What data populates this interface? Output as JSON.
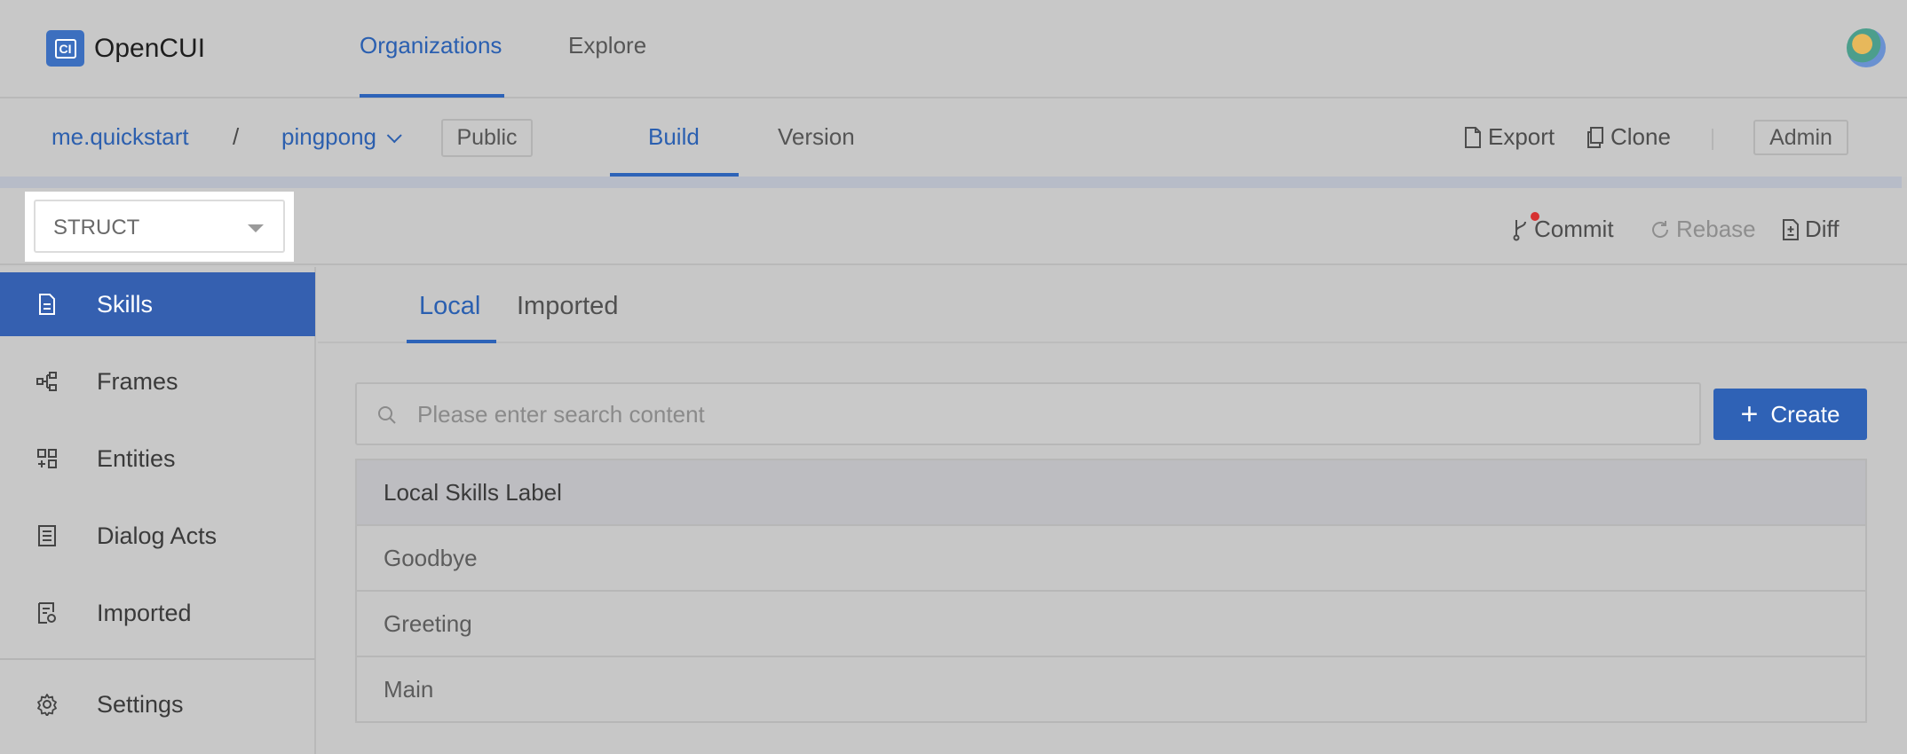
{
  "app": {
    "name": "OpenCUI"
  },
  "topnav": {
    "links": [
      {
        "label": "Organizations"
      },
      {
        "label": "Explore"
      }
    ]
  },
  "project": {
    "org": "me.quickstart",
    "separator": "/",
    "name": "pingpong",
    "visibility": "Public",
    "tabs": [
      {
        "label": "Build"
      },
      {
        "label": "Version"
      }
    ],
    "actions": {
      "export": "Export",
      "clone": "Clone",
      "admin": "Admin"
    }
  },
  "toolbar": {
    "mode_select": {
      "value": "STRUCT"
    },
    "commit": "Commit",
    "rebase": "Rebase",
    "diff": "Diff"
  },
  "sidebar": {
    "items": [
      {
        "label": "Skills",
        "icon": "document-icon",
        "active": true
      },
      {
        "label": "Frames",
        "icon": "frames-icon"
      },
      {
        "label": "Entities",
        "icon": "entities-icon"
      },
      {
        "label": "Dialog Acts",
        "icon": "dialog-acts-icon"
      },
      {
        "label": "Imported",
        "icon": "imported-icon"
      },
      {
        "label": "Settings",
        "icon": "gear-icon"
      }
    ]
  },
  "main": {
    "tabs": [
      {
        "label": "Local"
      },
      {
        "label": "Imported"
      }
    ],
    "search": {
      "placeholder": "Please enter search content"
    },
    "create_label": "Create",
    "table": {
      "header": "Local Skills Label",
      "rows": [
        "Goodbye",
        "Greeting",
        "Main"
      ]
    }
  },
  "colors": {
    "accent": "#2f62b6",
    "overlay": "#c8c8c8",
    "commit_dot": "#d63030"
  }
}
